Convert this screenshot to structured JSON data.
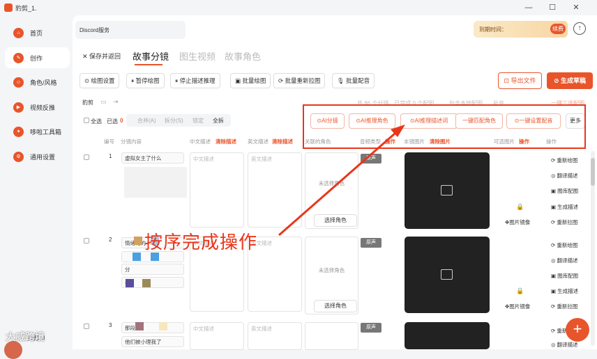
{
  "window": {
    "title": "豹剪_1.",
    "controls": [
      "—",
      "☐",
      "✕"
    ]
  },
  "sidebar": {
    "items": [
      {
        "label": "首页",
        "icon": "home-icon"
      },
      {
        "label": "创作",
        "icon": "create-icon"
      },
      {
        "label": "角色/风格",
        "icon": "role-icon"
      },
      {
        "label": "视频反推",
        "icon": "video-icon"
      },
      {
        "label": "哆啦工具箱",
        "icon": "toolbox-icon"
      },
      {
        "label": "通用设置",
        "icon": "settings-icon"
      }
    ],
    "user_name": "豹剪AI"
  },
  "header": {
    "doc_name": "Discord服务",
    "expiry_text": "到期时间：",
    "renew_label": "续费",
    "upload_icon": "↑"
  },
  "nav": {
    "back_label": "✕ 保存并返回",
    "tabs": [
      "故事分镜",
      "图生视频",
      "故事角色"
    ]
  },
  "toolbar": {
    "buttons": [
      "⊙ 绘图设置",
      "⏸ 暂停绘图",
      "⏸ 停止描述推理",
      "▣ 批量绘图",
      "⟳ 批量重新拉图",
      "🎙 批量配音"
    ],
    "export_label": "⊡ 导出文件",
    "generate_label": "⊘ 生成草稿"
  },
  "controls": {
    "section_label": "豹剪",
    "select_all": "全选",
    "selected_label": "已选",
    "selected_count": "0",
    "segment": [
      "合并(A)",
      "拆分(S)",
      "锁定",
      "全拆"
    ],
    "faded_status": "共 86 个分镜，已完成 0 个配图",
    "faded_checkbox": "包含本地配图",
    "faded_more": "补充",
    "faded_right": "一键三选配图"
  },
  "ai_buttons": [
    "⊙AI分镜",
    "⊙AI推理角色",
    "⊙AI推理描述词",
    "一键匹配角色",
    "⊙一键设置配音"
  ],
  "more_label": "更多",
  "columns": {
    "num": "编号",
    "content": "分镜内容",
    "cn_desc": "中文描述",
    "cn_clear": "清除描述",
    "en_desc": "英文描述",
    "en_clear": "清除描述",
    "roles": "关联的角色",
    "voice": "音频类型",
    "voice_clear": "操作",
    "image": "本镜图片",
    "image_clear": "清除图片",
    "alt_image": "可选图片",
    "alt_op": "操作",
    "ops": "操作"
  },
  "rows": [
    {
      "num": "1",
      "snippets": [
        "虚拟女主了什么"
      ],
      "cn_ph": "中文描述",
      "en_ph": "英文描述",
      "role_none": "未选择角色",
      "role_btn": "选择角色",
      "voice": "原声",
      "mirror": "✥图片镜像"
    },
    {
      "num": "2",
      "snippets": [
        "情绪化的",
        "",
        "分",
        "看"
      ],
      "cn_ph": "中文描述",
      "en_ph": "英文描述",
      "role_none": "未选择角色",
      "role_btn": "选择角色",
      "voice": "原声",
      "mirror": "✥图片镜像"
    },
    {
      "num": "3",
      "snippets": [
        "那段",
        "他们被小理我了"
      ],
      "cn_ph": "中文描述",
      "en_ph": "英文描述",
      "voice": "原声"
    }
  ],
  "row_ops": [
    "⟳ 重新绘图",
    "◎ 翻译描述",
    "▣ 图库配图",
    "▣ 生成描述",
    "⟳ 重新拉图"
  ],
  "annotation": "按序完成操作",
  "watermark": "大威跨境",
  "fab_label": "+"
}
